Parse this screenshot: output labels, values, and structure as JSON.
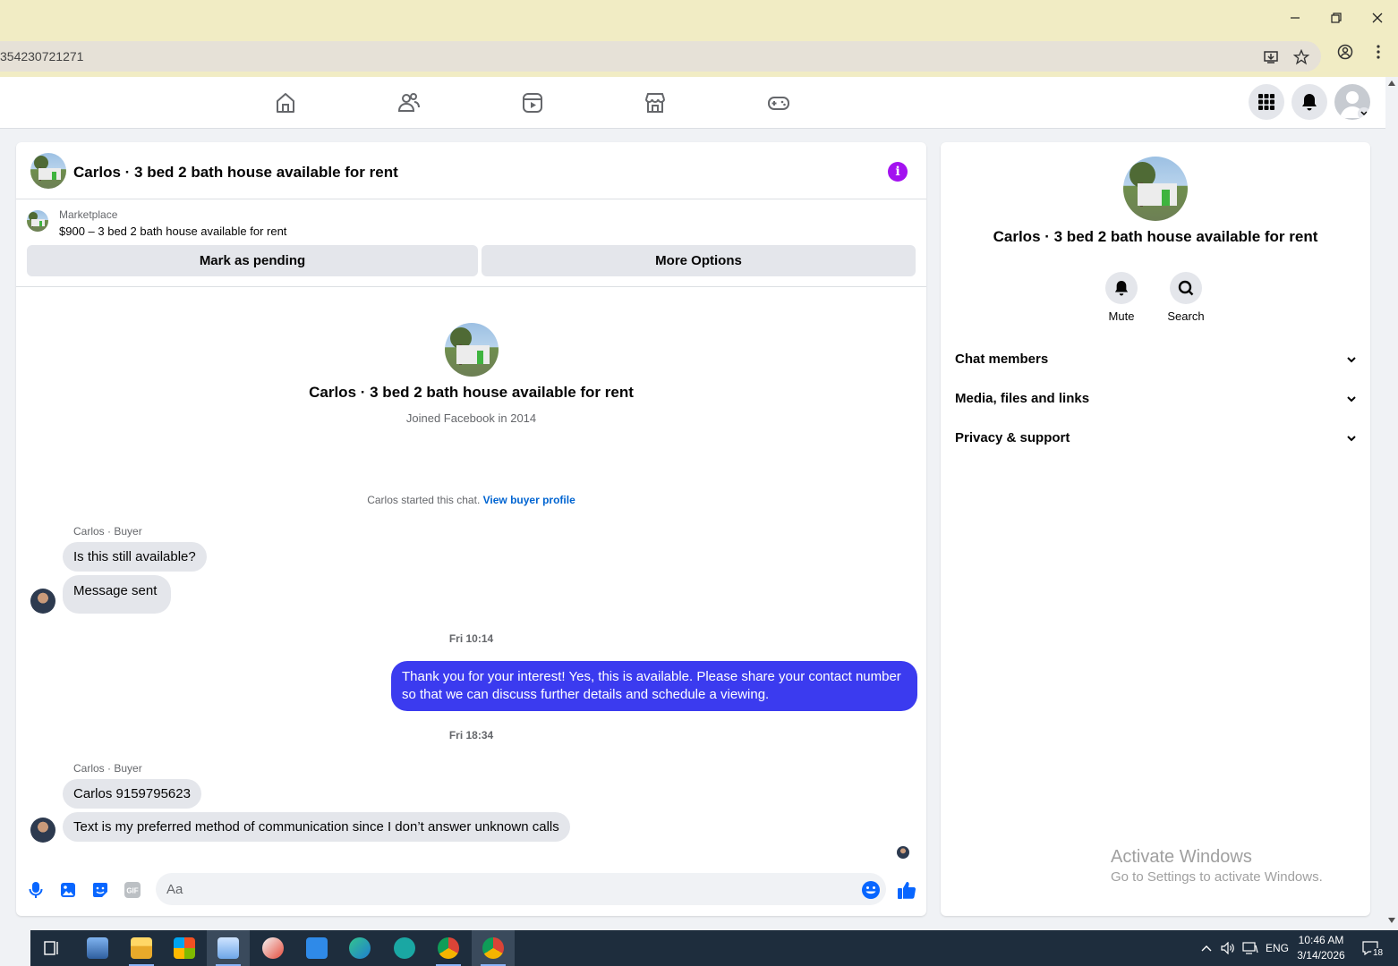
{
  "browser": {
    "url": "354230721271",
    "window_controls": [
      "minimize-icon",
      "restore-icon",
      "close-icon"
    ]
  },
  "fb_nav": {
    "icons": [
      "home-icon",
      "friends-icon",
      "video-icon",
      "marketplace-icon",
      "gaming-icon"
    ],
    "right": [
      "menu-grid-icon",
      "notifications-icon",
      "account-avatar"
    ]
  },
  "chat": {
    "title": "Carlos · 3 bed 2 bath house available for rent",
    "listing": {
      "label": "Marketplace",
      "title": "$900 – 3 bed 2 bath house available for rent",
      "pending_label": "Mark as pending",
      "more_label": "More Options"
    },
    "profile": {
      "name": "Carlos · 3 bed 2 bath house available for rent",
      "joined": "Joined Facebook in 2014"
    },
    "started_text": "Carlos started this chat.",
    "view_buyer_label": "View buyer profile",
    "sender_label": "Carlos · Buyer",
    "messages": [
      {
        "text": "Is this still available?"
      },
      {
        "text": "Message sent"
      },
      {
        "time": "Fri 10:14"
      },
      {
        "text": "Thank you for your interest! Yes, this is available. Please share your contact number so that we can discuss further details and schedule a viewing."
      },
      {
        "time": "Fri 18:34"
      },
      {
        "text": "Carlos 9159795623"
      },
      {
        "text": "Text is my preferred method of communication since I don’t answer unknown calls"
      }
    ],
    "composer": {
      "placeholder": "Aa"
    }
  },
  "side": {
    "name": "Carlos · 3 bed 2 bath house available for rent",
    "mute_label": "Mute",
    "search_label": "Search",
    "sections": [
      "Chat members",
      "Media, files and links",
      "Privacy & support"
    ],
    "watermark_title": "Activate Windows",
    "watermark_sub": "Go to Settings to activate Windows."
  },
  "taskbar": {
    "lang": "ENG",
    "time": "10:46 AM",
    "date": "3/14/2026",
    "notifications": "18"
  },
  "colors": {
    "accent": "#3b3bef",
    "link": "#0064d1",
    "info": "#a312f0",
    "titlebar": "#f1ecc4"
  }
}
